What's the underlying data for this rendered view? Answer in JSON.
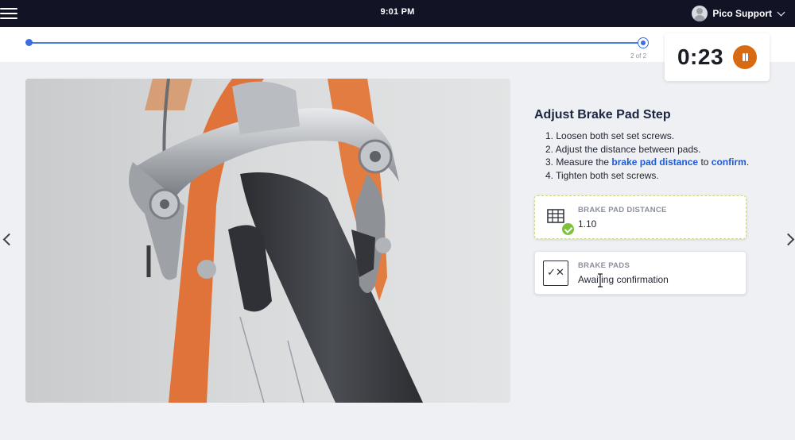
{
  "topbar": {
    "menu_icon": "hamburger-menu-icon",
    "time": "9:01 PM",
    "user_name": "Pico Support",
    "user_icon": "avatar-icon",
    "dropdown_icon": "chevron-down-icon"
  },
  "progress": {
    "current_step": 2,
    "total_steps": 2,
    "step_count_label": "2 of 2",
    "track_color": "#4a7be6"
  },
  "timer": {
    "value": "0:23",
    "pause_icon": "pause-icon",
    "button_color": "#d86a12"
  },
  "photo": {
    "subject_icon": "bicycle-brake-photo"
  },
  "navigation": {
    "prev_icon": "chevron-left-icon",
    "next_icon": "chevron-right-icon"
  },
  "instructions": {
    "title": "Adjust Brake Pad Step",
    "steps": {
      "s1": "1. Loosen both set set screws.",
      "s2": "2. Adjust the distance between pads.",
      "s3_prefix": "3. Measure the ",
      "s3_link1": "brake pad distance",
      "s3_mid": " to ",
      "s3_link2": "confirm",
      "s3_suffix": ".",
      "s4": "4. Tighten both set screws."
    },
    "link_color": "#1e5ad6"
  },
  "cards": {
    "distance": {
      "label": "BRAKE PAD DISTANCE",
      "value": "1.10",
      "icon": "measurement-grid-icon",
      "status_icon": "check-icon",
      "status_color": "#7cc23a"
    },
    "pads": {
      "label": "BRAKE PADS",
      "value": "Awaiting confirmation",
      "icon": "check-x-box-icon",
      "icon_text": "✓✕"
    }
  }
}
